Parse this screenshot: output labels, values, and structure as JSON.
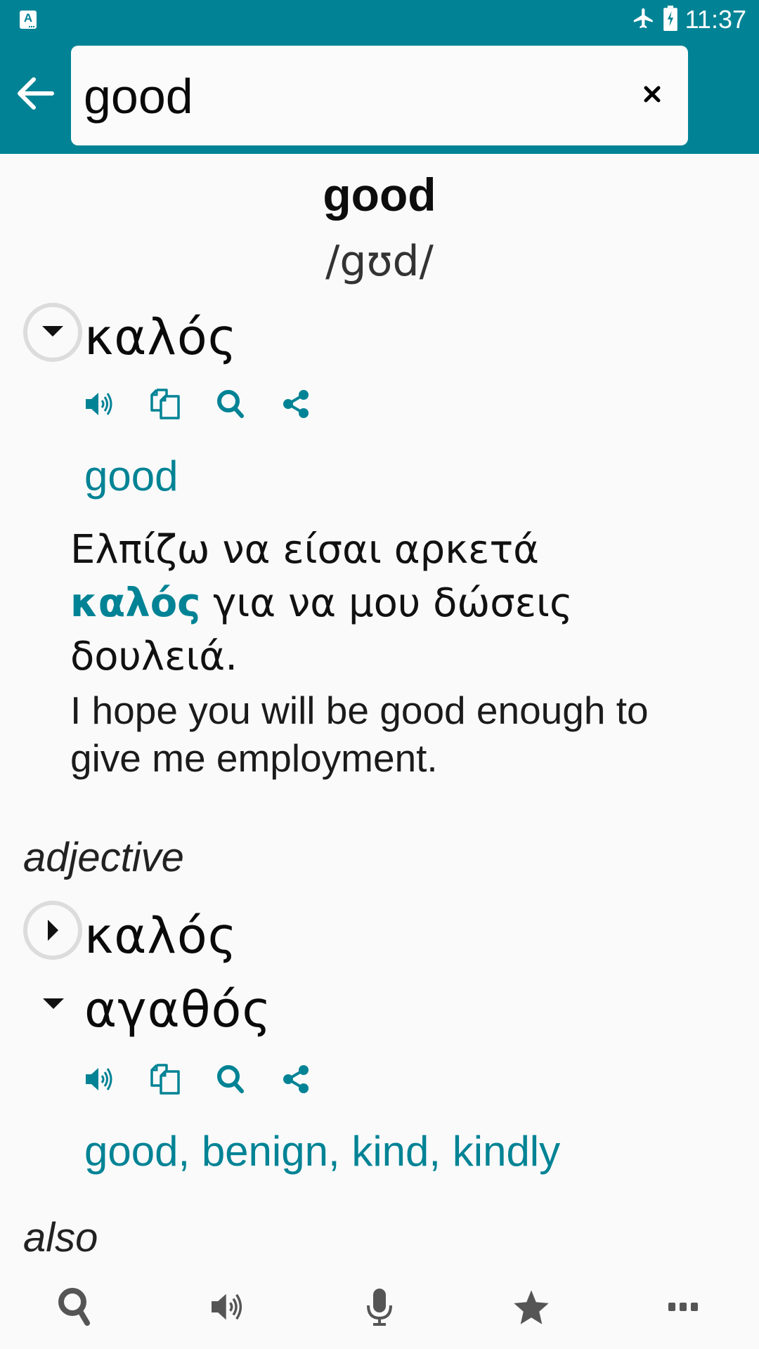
{
  "status_bar": {
    "app_icon": "dictionary-app-icon",
    "app_icon_letter": "A",
    "icons": [
      "airplane-mode-icon",
      "battery-charging-icon"
    ],
    "time": "11:37"
  },
  "search": {
    "value": "good",
    "placeholder": "",
    "back_icon": "back-arrow-icon",
    "clear_icon": "close-icon"
  },
  "entry": {
    "headword": "good",
    "pronunciation": "/gʊd/"
  },
  "top_translation": {
    "word": "καλός",
    "expanded": true,
    "actions": [
      "speaker-icon",
      "copy-icon",
      "search-icon",
      "share-icon"
    ],
    "meaning": "good",
    "example": {
      "greek_before": "Ελπίζω να είσαι αρκετά ",
      "greek_highlight": "καλός",
      "greek_after": " για να μου δώσεις δουλειά.",
      "english": "I hope you will be good enough to give me employment."
    }
  },
  "sections": [
    {
      "pos": "adjective",
      "items": [
        {
          "word": "καλός",
          "expanded": false
        },
        {
          "word": "αγαθός",
          "expanded": true,
          "actions": [
            "speaker-icon",
            "copy-icon",
            "search-icon",
            "share-icon"
          ],
          "meaning": "good, benign, kind, kindly"
        }
      ]
    },
    {
      "pos": "also"
    }
  ],
  "bottom_nav": [
    {
      "name": "search",
      "icon": "search-icon"
    },
    {
      "name": "pronounce",
      "icon": "speaker-icon"
    },
    {
      "name": "voice-input",
      "icon": "microphone-icon"
    },
    {
      "name": "favorites",
      "icon": "star-icon"
    },
    {
      "name": "more",
      "icon": "more-icon"
    }
  ],
  "colors": {
    "accent": "#018395",
    "background": "#fafafa",
    "nav_icon": "#555555",
    "toggle_ring": "#dcdcdc"
  }
}
